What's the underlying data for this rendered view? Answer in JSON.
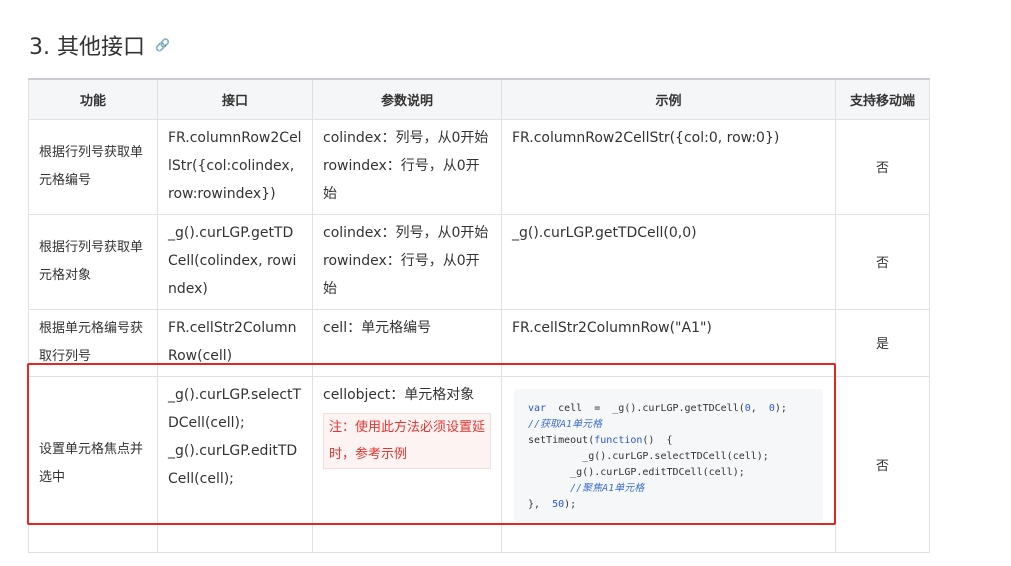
{
  "heading": {
    "title": "3. 其他接口",
    "icon": "link-icon"
  },
  "table": {
    "headers": [
      "功能",
      "接口",
      "参数说明",
      "示例",
      "支持移动端"
    ],
    "rows": [
      {
        "function": "根据行列号获取单元格编号",
        "api": "FR.columnRow2CellStr({col:colindex, row:rowindex})",
        "params": [
          "colindex：列号，从0开始",
          "rowindex：行号，从0开始"
        ],
        "example": "FR.columnRow2CellStr({col:0, row:0})",
        "mobile": "否"
      },
      {
        "function": "根据行列号获取单元格对象",
        "api": "_g().curLGP.getTDCell(colindex, rowindex)",
        "params": [
          "colindex：列号，从0开始",
          "rowindex：行号，从0开始"
        ],
        "example": "_g().curLGP.getTDCell(0,0)",
        "mobile": "否"
      },
      {
        "function": "根据单元格编号获取行列号",
        "api": "FR.cellStr2ColumnRow(cell)",
        "params": [
          "cell：单元格编号"
        ],
        "example": "FR.cellStr2ColumnRow(\"A1\")",
        "mobile": "是"
      },
      {
        "function": "设置单元格焦点并选中",
        "api_lines": [
          "_g().curLGP.selectTDCell(cell);",
          "_g().curLGP.editTDCell(cell);"
        ],
        "params": [
          "cellobject：单元格对象"
        ],
        "note": "注：使用此方法必须设置延时，参考示例",
        "code": {
          "line1_kw": "var",
          "line1": "  cell  =  _g().curLGP.getTDCell(",
          "line1_n1": "0",
          "line1_mid": ",  ",
          "line1_n2": "0",
          "line1_end": ");",
          "line2": "//获取A1单元格",
          "line3_a": "setTimeout(",
          "line3_kw": "function",
          "line3_b": "()  {",
          "line4": "         _g().curLGP.selectTDCell(cell);",
          "line5": "       _g().curLGP.editTDCell(cell);",
          "line6": "       //聚焦A1单元格",
          "line7_a": "},  ",
          "line7_n": "50",
          "line7_b": ");"
        },
        "mobile": "否"
      }
    ]
  },
  "colors": {
    "highlight": "#e52424",
    "note_text": "#e3342f",
    "keyword": "#2b57d6"
  }
}
